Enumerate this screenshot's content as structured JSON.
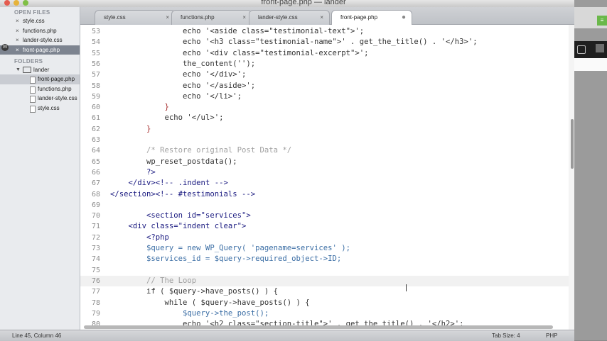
{
  "window": {
    "title": "front-page.php — lander"
  },
  "sidebar": {
    "open_files_header": "OPEN FILES",
    "open_files": [
      {
        "label": "style.css",
        "active": false
      },
      {
        "label": "functions.php",
        "active": false
      },
      {
        "label": "lander-style.css",
        "active": false
      },
      {
        "label": "front-page.php",
        "active": true
      }
    ],
    "folders_header": "FOLDERS",
    "folder": "lander",
    "files": [
      {
        "label": "front-page.php",
        "active": true
      },
      {
        "label": "functions.php",
        "active": false
      },
      {
        "label": "lander-style.css",
        "active": false
      },
      {
        "label": "style.css",
        "active": false
      }
    ]
  },
  "tabs": [
    {
      "label": "style.css",
      "close": "×",
      "active": false
    },
    {
      "label": "functions.php",
      "close": "×",
      "active": false
    },
    {
      "label": "lander-style.css",
      "close": "×",
      "active": false
    },
    {
      "label": "front-page.php",
      "close": "●",
      "active": true
    }
  ],
  "editor": {
    "lines": [
      {
        "n": "53",
        "text": "                echo '<aside class=\"testimonial-text\">';"
      },
      {
        "n": "54",
        "text": "                echo '<h3 class=\"testimonial-name\">' . get_the_title() . '</h3>';"
      },
      {
        "n": "55",
        "text": "                echo '<div class=\"testimonial-excerpt\">';"
      },
      {
        "n": "56",
        "text": "                the_content('');"
      },
      {
        "n": "57",
        "text": "                echo '</div>';"
      },
      {
        "n": "58",
        "text": "                echo '</aside>';"
      },
      {
        "n": "59",
        "text": "                echo '</li>';"
      },
      {
        "n": "60",
        "text": "            }"
      },
      {
        "n": "61",
        "text": "            echo '</ul>';"
      },
      {
        "n": "62",
        "text": "        }"
      },
      {
        "n": "63",
        "text": ""
      },
      {
        "n": "64",
        "text": "        /* Restore original Post Data */"
      },
      {
        "n": "65",
        "text": "        wp_reset_postdata();"
      },
      {
        "n": "66",
        "text": "        ?>"
      },
      {
        "n": "67",
        "text": "    </div><!-- .indent -->"
      },
      {
        "n": "68",
        "text": "</section><!-- #testimonials -->"
      },
      {
        "n": "69",
        "text": ""
      },
      {
        "n": "70",
        "text": "        <section id=\"services\">"
      },
      {
        "n": "71",
        "text": "    <div class=\"indent clear\">"
      },
      {
        "n": "72",
        "text": "        <?php"
      },
      {
        "n": "73",
        "text": "        $query = new WP_Query( 'pagename=services' );"
      },
      {
        "n": "74",
        "text": "        $services_id = $query->required_object->ID;"
      },
      {
        "n": "75",
        "text": ""
      },
      {
        "n": "76",
        "text": "        // The Loop"
      },
      {
        "n": "77",
        "text": "        if ( $query->have_posts() ) {"
      },
      {
        "n": "78",
        "text": "            while ( $query->have_posts() ) {"
      },
      {
        "n": "79",
        "text": "                $query->the_post();"
      },
      {
        "n": "80",
        "text": "                echo '<h2 class=\"section-title\">' . get_the_title() . '</h2>';"
      }
    ]
  },
  "status": {
    "position": "Line 45, Column 46",
    "tab_size": "Tab Size: 4",
    "syntax": "PHP"
  }
}
